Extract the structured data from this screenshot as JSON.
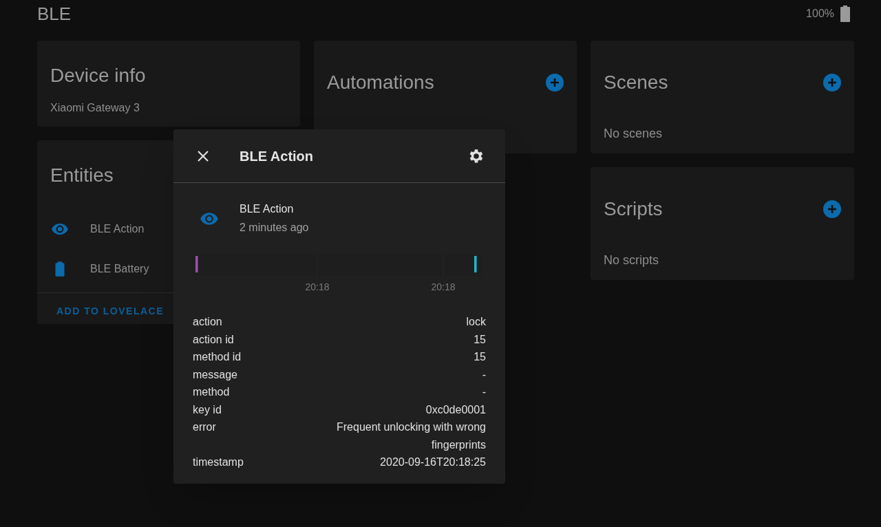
{
  "header": {
    "title": "BLE",
    "battery_text": "100%"
  },
  "device_info": {
    "title": "Device info",
    "model": "Xiaomi Gateway 3"
  },
  "automations": {
    "title": "Automations"
  },
  "scenes": {
    "title": "Scenes",
    "empty": "No scenes"
  },
  "scripts": {
    "title": "Scripts",
    "empty": "No scripts"
  },
  "entities": {
    "title": "Entities",
    "items": [
      {
        "name": "BLE Action",
        "kind": "eye"
      },
      {
        "name": "BLE Battery",
        "kind": "battery"
      }
    ],
    "action": "ADD TO LOVELACE"
  },
  "dialog": {
    "title": "BLE Action",
    "entity": {
      "name": "BLE Action",
      "kind": "eye",
      "last_changed": "2 minutes ago"
    },
    "timeline": {
      "ticks": [
        "20:18",
        "20:18"
      ]
    },
    "attributes": [
      {
        "key": "action",
        "value": "lock"
      },
      {
        "key": "action id",
        "value": "15"
      },
      {
        "key": "method id",
        "value": "15"
      },
      {
        "key": "message",
        "value": "-"
      },
      {
        "key": "method",
        "value": "-"
      },
      {
        "key": "key id",
        "value": "0xc0de0001"
      },
      {
        "key": "error",
        "value": "Frequent unlocking with wrong fingerprints"
      },
      {
        "key": "timestamp",
        "value": "2020-09-16T20:18:25"
      }
    ]
  }
}
